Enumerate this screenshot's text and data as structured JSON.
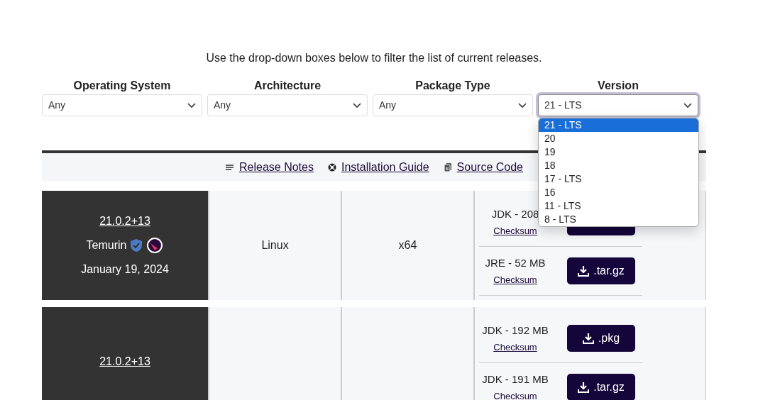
{
  "intro": "Use the drop-down boxes below to filter the list of current releases.",
  "filters": [
    {
      "label": "Operating System",
      "value": "Any",
      "open": false
    },
    {
      "label": "Architecture",
      "value": "Any",
      "open": false
    },
    {
      "label": "Package Type",
      "value": "Any",
      "open": false
    },
    {
      "label": "Version",
      "value": "21 - LTS",
      "open": true,
      "options": [
        {
          "label": "21 - LTS",
          "selected": true
        },
        {
          "label": "20",
          "selected": false
        },
        {
          "label": "19",
          "selected": false
        },
        {
          "label": "18",
          "selected": false
        },
        {
          "label": "17 - LTS",
          "selected": false
        },
        {
          "label": "16",
          "selected": false
        },
        {
          "label": "11 - LTS",
          "selected": false
        },
        {
          "label": "8 - LTS",
          "selected": false
        }
      ]
    }
  ],
  "links": [
    {
      "label": "Release Notes",
      "kind": "notes"
    },
    {
      "label": "Installation Guide",
      "kind": "guide"
    },
    {
      "label": "Source Code",
      "kind": "source"
    }
  ],
  "releases": [
    {
      "version": "21.0.2+13",
      "vendor": "Temurin",
      "date": "January 19, 2024",
      "os": "Linux",
      "arch": "x64",
      "packages": [
        {
          "label": "JDK - 208",
          "checksum": "Checksum"
        },
        {
          "label": "JRE - 52 MB",
          "checksum": "Checksum",
          "button": ".tar.gz"
        }
      ]
    },
    {
      "version": "21.0.2+13",
      "packages": [
        {
          "label": "JDK - 192 MB",
          "checksum": "Checksum",
          "button": ".pkg"
        },
        {
          "label": "JDK - 191 MB",
          "checksum": "Checksum",
          "button": ".tar.gz"
        }
      ]
    }
  ]
}
